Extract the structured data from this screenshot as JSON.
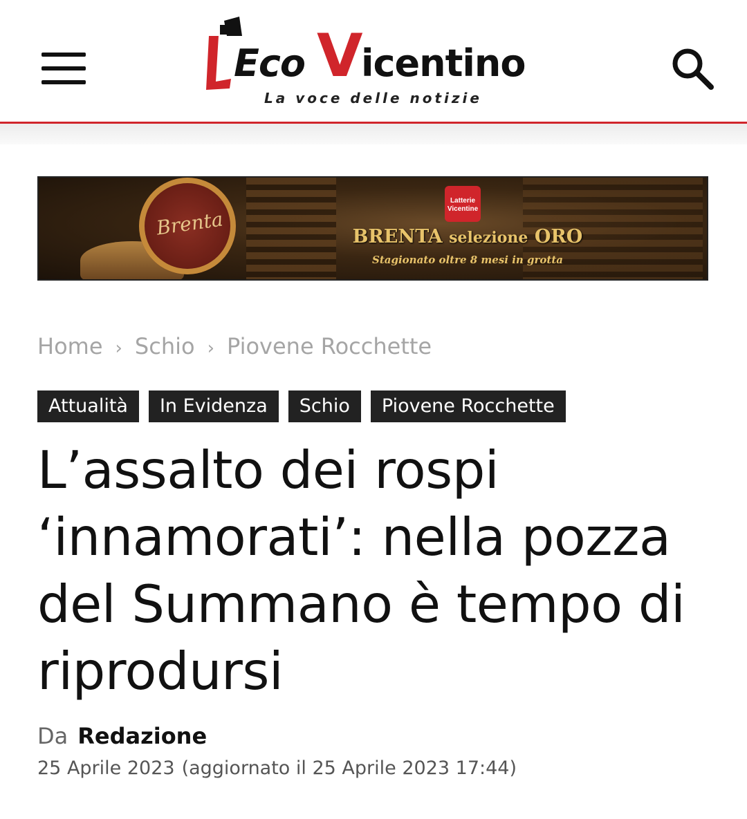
{
  "header": {
    "logo_l": "L'",
    "logo_eco": "Eco",
    "logo_v": "V",
    "logo_icentino": "icentino",
    "tagline": "La voce delle notizie",
    "brand_color": "#d0252b",
    "menu_icon": "hamburger-menu-icon",
    "search_icon": "search-icon"
  },
  "ad": {
    "brand": "Latterie Vicentine",
    "cheese_label": "Brenta",
    "title_main": "BRENTA",
    "title_rest": "selezione",
    "title_end": "ORO",
    "subtitle": "Stagionato oltre 8 mesi in grotta"
  },
  "breadcrumb": {
    "items": [
      "Home",
      "Schio",
      "Piovene Rocchette"
    ],
    "separator": "›"
  },
  "tags": [
    "Attualità",
    "In Evidenza",
    "Schio",
    "Piovene Rocchette"
  ],
  "article": {
    "title": "L’assalto dei rospi ‘innamorati’: nella pozza del Summano è tempo di riprodursi",
    "author_prefix": "Da",
    "author": "Redazione",
    "date": "25 Aprile 2023",
    "updated": "(aggiornato il 25 Aprile 2023 17:44)"
  }
}
